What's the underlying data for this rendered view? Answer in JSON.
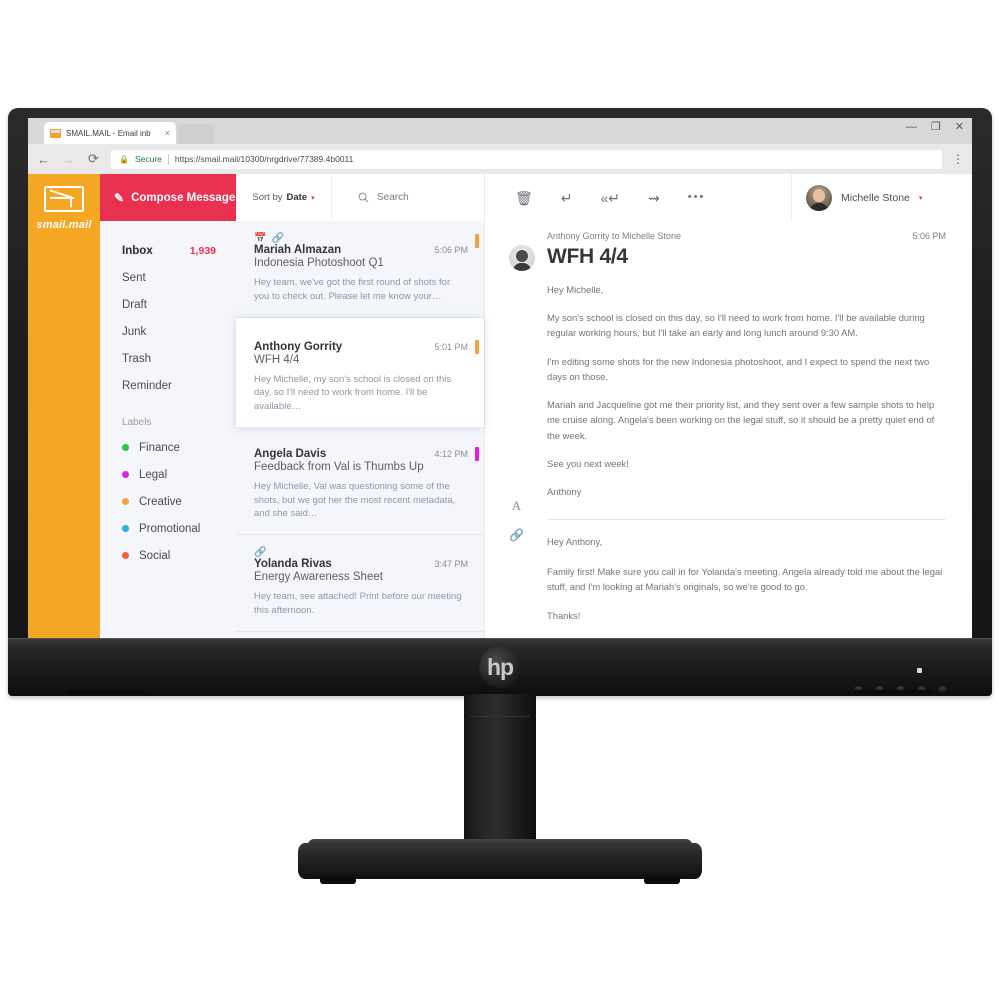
{
  "browser": {
    "tab_title": "SMAIL.MAIL - Email inb",
    "tab_close": "×",
    "back_icon": "←",
    "forward_icon": "→",
    "reload_icon": "⟳",
    "lock_icon": "🔒",
    "secure_label": "Secure",
    "url": "https://smail.mail/10300/nrgdrive/77389.4b0011",
    "menu_icon": "⋮",
    "minimize_icon": "—",
    "maximize_icon": "❐",
    "close_icon": "✕"
  },
  "brand": {
    "name": "smail.mail"
  },
  "compose": {
    "label": "Compose Message",
    "icon": "✍"
  },
  "sidebar": {
    "folders": [
      {
        "label": "Inbox",
        "count": "1,939"
      },
      {
        "label": "Sent",
        "count": ""
      },
      {
        "label": "Draft",
        "count": ""
      },
      {
        "label": "Junk",
        "count": ""
      },
      {
        "label": "Trash",
        "count": ""
      },
      {
        "label": "Reminder",
        "count": ""
      }
    ],
    "labels_heading": "Labels",
    "labels": [
      {
        "label": "Finance",
        "color": "#22c93f"
      },
      {
        "label": "Legal",
        "color": "#e21ee2"
      },
      {
        "label": "Creative",
        "color": "#f0a43a"
      },
      {
        "label": "Promotional",
        "color": "#1fb6e0"
      },
      {
        "label": "Social",
        "color": "#f0622a"
      }
    ]
  },
  "listbar": {
    "sort_prefix": "Sort by ",
    "sort_value": "Date",
    "caret": "▾",
    "search_icon": "search-icon",
    "search_placeholder": "Search"
  },
  "toolbar": {
    "delete_icon": "🗑",
    "reply_icon": "↩",
    "reply_all_icon": "↩↩",
    "forward_icon": "⇨",
    "more_icon": "•••"
  },
  "user": {
    "name": "Michelle Stone",
    "caret": "▾"
  },
  "emails": [
    {
      "from": "Mariah Almazan",
      "time": "5:06 PM",
      "subject": "Indonesia Photoshoot Q1",
      "preview": "Hey team, we've got the first round of shots for you to check out. Please let me know your…",
      "flag": "#f0a43a",
      "icons": [
        "calendar-icon",
        "attachment-icon"
      ],
      "selected": false
    },
    {
      "from": "Anthony Gorrity",
      "time": "5:01 PM",
      "subject": "WFH 4/4",
      "preview": "Hey Michelle, my son's school is closed on this day, so I'll need to work from home. I'll be available…",
      "flag": "#f0a43a",
      "icons": [],
      "selected": true
    },
    {
      "from": "Angela Davis",
      "time": "4:12 PM",
      "subject": "Feedback from Val is Thumbs Up",
      "preview": "Hey Michelle, Val was questioning some of the shots, but we got her the most recent metadata, and she said…",
      "flag": "#e21ee2",
      "icons": [],
      "selected": false
    },
    {
      "from": "Yolanda Rivas",
      "time": "3:47 PM",
      "subject": "Energy Awareness Sheet",
      "preview": "Hey team, see attached! Print before our meeting this afternoon.",
      "flag": "",
      "icons": [
        "attachment-icon"
      ],
      "selected": false
    }
  ],
  "reading": {
    "meta": "Anthony Gorrity to Michelle Stone",
    "time": "5:06 PM",
    "subject": "WFH 4/4",
    "paragraphs": [
      "Hey Michelle,",
      "My son's school is closed on this day, so I'll need to work from home. I'll be available during regular working hours, but I'll take an early and long lunch around 9:30 AM.",
      "I'm editing some shots for the new Indonesia photoshoot, and I expect to spend the next two days on those.",
      "Mariah and Jacqueline got me their priority list, and they sent over a few sample shots to help me cruise along. Angela's been working on the legal stuff, so it should be a pretty quiet end of the week.",
      "See you next week!",
      "Anthony"
    ],
    "reply_font_icon": "A",
    "reply_attach_icon": "attachment-icon",
    "reply_paragraphs": [
      "Hey Anthony,",
      "Family first! Make sure you call in for Yolanda's meeting. Angela already told me about the legal stuff, and I'm looking at Mariah's originals, so we're good to go.",
      "Thanks!"
    ]
  },
  "hardware": {
    "brand_logo": "hp"
  }
}
